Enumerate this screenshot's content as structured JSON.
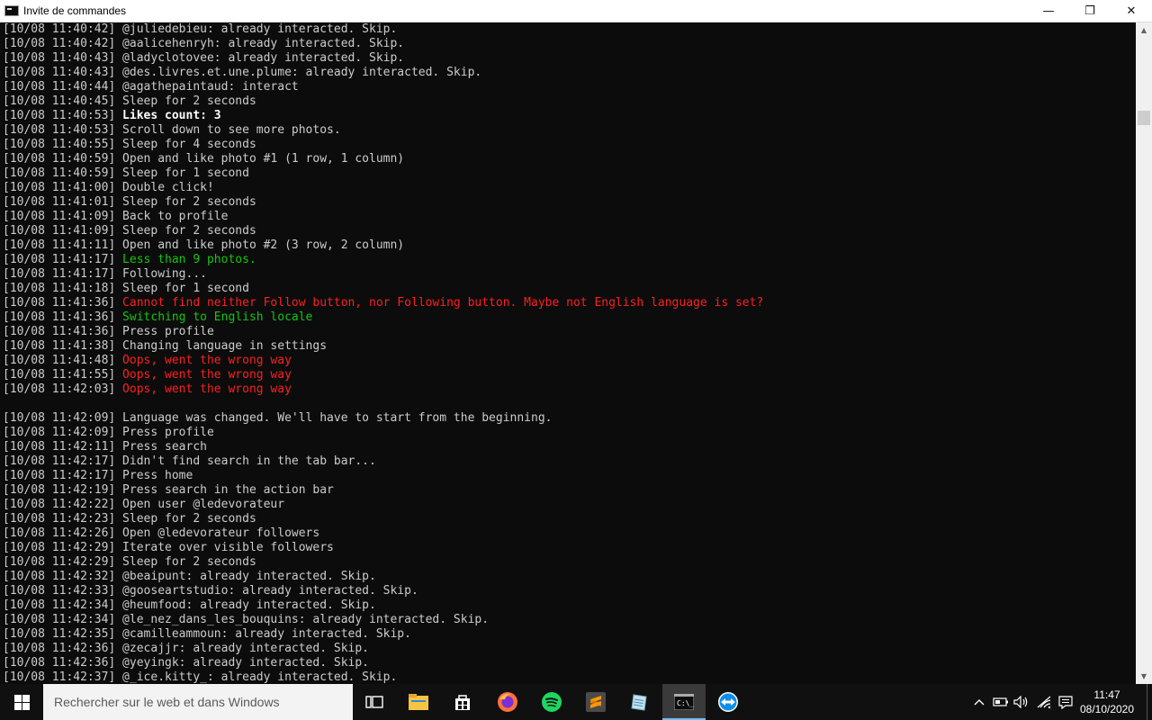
{
  "window": {
    "title": "Invite de commandes",
    "controls": {
      "minimize": "—",
      "maximize": "❐",
      "close": "✕"
    }
  },
  "console_lines": [
    {
      "ts": "[10/08 11:40:42]",
      "msg": " @juliedebieu: already interacted. Skip.",
      "style": "normal"
    },
    {
      "ts": "[10/08 11:40:42]",
      "msg": " @aalicehenryh: already interacted. Skip.",
      "style": "normal"
    },
    {
      "ts": "[10/08 11:40:43]",
      "msg": " @ladyclotovee: already interacted. Skip.",
      "style": "normal"
    },
    {
      "ts": "[10/08 11:40:43]",
      "msg": " @des.livres.et.une.plume: already interacted. Skip.",
      "style": "normal"
    },
    {
      "ts": "[10/08 11:40:44]",
      "msg": " @agathepaintaud: interact",
      "style": "normal"
    },
    {
      "ts": "[10/08 11:40:45]",
      "msg": " Sleep for 2 seconds",
      "style": "normal"
    },
    {
      "ts": "[10/08 11:40:53]",
      "msg": " Likes count: 3",
      "style": "bold"
    },
    {
      "ts": "[10/08 11:40:53]",
      "msg": " Scroll down to see more photos.",
      "style": "normal"
    },
    {
      "ts": "[10/08 11:40:55]",
      "msg": " Sleep for 4 seconds",
      "style": "normal"
    },
    {
      "ts": "[10/08 11:40:59]",
      "msg": " Open and like photo #1 (1 row, 1 column)",
      "style": "normal"
    },
    {
      "ts": "[10/08 11:40:59]",
      "msg": " Sleep for 1 second",
      "style": "normal"
    },
    {
      "ts": "[10/08 11:41:00]",
      "msg": " Double click!",
      "style": "normal"
    },
    {
      "ts": "[10/08 11:41:01]",
      "msg": " Sleep for 2 seconds",
      "style": "normal"
    },
    {
      "ts": "[10/08 11:41:09]",
      "msg": " Back to profile",
      "style": "normal"
    },
    {
      "ts": "[10/08 11:41:09]",
      "msg": " Sleep for 2 seconds",
      "style": "normal"
    },
    {
      "ts": "[10/08 11:41:11]",
      "msg": " Open and like photo #2 (3 row, 2 column)",
      "style": "normal"
    },
    {
      "ts": "[10/08 11:41:17]",
      "msg": " Less than 9 photos.",
      "style": "green"
    },
    {
      "ts": "[10/08 11:41:17]",
      "msg": " Following...",
      "style": "normal"
    },
    {
      "ts": "[10/08 11:41:18]",
      "msg": " Sleep for 1 second",
      "style": "normal"
    },
    {
      "ts": "[10/08 11:41:36]",
      "msg": " Cannot find neither Follow button, nor Following button. Maybe not English language is set?",
      "style": "red2"
    },
    {
      "ts": "[10/08 11:41:36]",
      "msg": " Switching to English locale",
      "style": "green"
    },
    {
      "ts": "[10/08 11:41:36]",
      "msg": " Press profile",
      "style": "normal"
    },
    {
      "ts": "[10/08 11:41:38]",
      "msg": " Changing language in settings",
      "style": "normal"
    },
    {
      "ts": "[10/08 11:41:48]",
      "msg": " Oops, went the wrong way",
      "style": "red2"
    },
    {
      "ts": "[10/08 11:41:55]",
      "msg": " Oops, went the wrong way",
      "style": "red2"
    },
    {
      "ts": "[10/08 11:42:03]",
      "msg": " Oops, went the wrong way",
      "style": "red2"
    },
    {
      "ts": "",
      "msg": "",
      "style": "normal"
    },
    {
      "ts": "[10/08 11:42:09]",
      "msg": " Language was changed. We'll have to start from the beginning.",
      "style": "normal"
    },
    {
      "ts": "[10/08 11:42:09]",
      "msg": " Press profile",
      "style": "normal"
    },
    {
      "ts": "[10/08 11:42:11]",
      "msg": " Press search",
      "style": "normal"
    },
    {
      "ts": "[10/08 11:42:17]",
      "msg": " Didn't find search in the tab bar...",
      "style": "normal"
    },
    {
      "ts": "[10/08 11:42:17]",
      "msg": " Press home",
      "style": "normal"
    },
    {
      "ts": "[10/08 11:42:19]",
      "msg": " Press search in the action bar",
      "style": "normal"
    },
    {
      "ts": "[10/08 11:42:22]",
      "msg": " Open user @ledevorateur",
      "style": "normal"
    },
    {
      "ts": "[10/08 11:42:23]",
      "msg": " Sleep for 2 seconds",
      "style": "normal"
    },
    {
      "ts": "[10/08 11:42:26]",
      "msg": " Open @ledevorateur followers",
      "style": "normal"
    },
    {
      "ts": "[10/08 11:42:29]",
      "msg": " Iterate over visible followers",
      "style": "normal"
    },
    {
      "ts": "[10/08 11:42:29]",
      "msg": " Sleep for 2 seconds",
      "style": "normal"
    },
    {
      "ts": "[10/08 11:42:32]",
      "msg": " @beaipunt: already interacted. Skip.",
      "style": "normal"
    },
    {
      "ts": "[10/08 11:42:33]",
      "msg": " @gooseartstudio: already interacted. Skip.",
      "style": "normal"
    },
    {
      "ts": "[10/08 11:42:34]",
      "msg": " @heumfood: already interacted. Skip.",
      "style": "normal"
    },
    {
      "ts": "[10/08 11:42:34]",
      "msg": " @le_nez_dans_les_bouquins: already interacted. Skip.",
      "style": "normal"
    },
    {
      "ts": "[10/08 11:42:35]",
      "msg": " @camilleammoun: already interacted. Skip.",
      "style": "normal"
    },
    {
      "ts": "[10/08 11:42:36]",
      "msg": " @zecajjr: already interacted. Skip.",
      "style": "normal"
    },
    {
      "ts": "[10/08 11:42:36]",
      "msg": " @yeyingk: already interacted. Skip.",
      "style": "normal"
    },
    {
      "ts": "[10/08 11:42:37]",
      "msg": " @_ice.kitty_: already interacted. Skip.",
      "style": "normal"
    }
  ],
  "taskbar": {
    "search_placeholder": "Rechercher sur le web et dans Windows",
    "pinned": [
      "task-view-icon",
      "file-explorer-icon",
      "store-icon",
      "firefox-icon",
      "spotify-icon",
      "sublime-text-icon",
      "notepad-icon",
      "command-prompt-icon",
      "teamviewer-icon"
    ],
    "clock_time": "11:47",
    "clock_date": "08/10/2020"
  },
  "colors": {
    "console_bg": "#0c0c0c",
    "console_text": "#cccccc",
    "green": "#16c60c",
    "red": "#ff1f1f",
    "taskbar_bg": "#101010"
  }
}
